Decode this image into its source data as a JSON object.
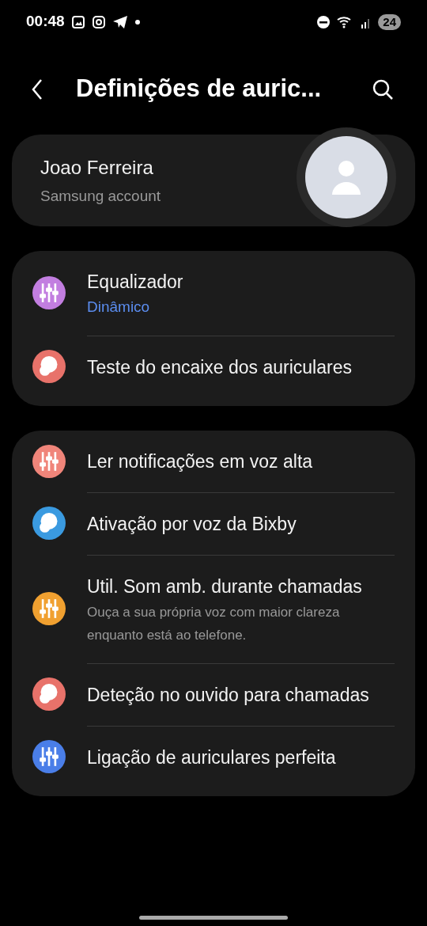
{
  "status_bar": {
    "time": "00:48",
    "battery": "24"
  },
  "header": {
    "title": "Definições de auric..."
  },
  "account": {
    "name": "Joao Ferreira",
    "subtitle": "Samsung account"
  },
  "groups": [
    {
      "items": [
        {
          "title": "Equalizador",
          "value": "Dinâmico",
          "color": "#c27ee0"
        },
        {
          "title": "Teste do encaixe dos auriculares",
          "color": "#e8726a"
        }
      ]
    },
    {
      "items": [
        {
          "title": "Ler notificações em voz alta",
          "color": "#f0857a"
        },
        {
          "title": "Ativação por voz da Bixby",
          "color": "#3a9ae0"
        },
        {
          "title": "Util. Som amb. durante chamadas",
          "description": "Ouça a sua própria voz com maior clareza enquanto está ao telefone.",
          "color": "#f0a030"
        },
        {
          "title": "Deteção no ouvido para chamadas",
          "color": "#e8726a"
        },
        {
          "title": "Ligação de auriculares perfeita",
          "color": "#4a7ee8"
        }
      ]
    }
  ]
}
